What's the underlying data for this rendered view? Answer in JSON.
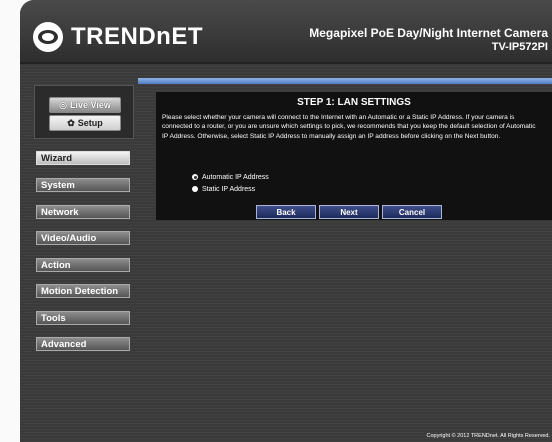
{
  "header": {
    "logo_text": "TRENDnET",
    "product_title": "Megapixel PoE Day/Night Internet Camera",
    "product_model": "TV-IP572PI"
  },
  "view_panel": {
    "live_view_label": "Live View",
    "live_view_icon": "camera-icon",
    "setup_label": "Setup",
    "setup_icon": "gear-icon"
  },
  "sidebar": {
    "items": [
      {
        "label": "Wizard",
        "active": true
      },
      {
        "label": "System",
        "active": false
      },
      {
        "label": "Network",
        "active": false
      },
      {
        "label": "Video/Audio",
        "active": false
      },
      {
        "label": "Action",
        "active": false
      },
      {
        "label": "Motion Detection",
        "active": false
      },
      {
        "label": "Tools",
        "active": false
      },
      {
        "label": "Advanced",
        "active": false
      }
    ]
  },
  "content": {
    "title": "STEP 1: LAN SETTINGS",
    "description": "Please select whether your camera will connect to the Internet with an Automatic or a Static IP Address. If your camera is connected to a router, or you are unsure which settings to pick, we recommends that you keep the default selection of Automatic IP Address. Otherwise, select Static IP Address to manually assign an IP address before clicking on the Next button.",
    "options": [
      {
        "label": "Automatic IP Address",
        "selected": true
      },
      {
        "label": "Static IP Address",
        "selected": false
      }
    ],
    "buttons": {
      "back": "Back",
      "next": "Next",
      "cancel": "Cancel"
    }
  },
  "footer": {
    "copyright": "Copyright © 2012 TRENDnet. All Rights Reserved."
  },
  "colors": {
    "accent_bar": "#6f97d6",
    "button_bg": "#263466",
    "background": "#3a3a3a"
  }
}
